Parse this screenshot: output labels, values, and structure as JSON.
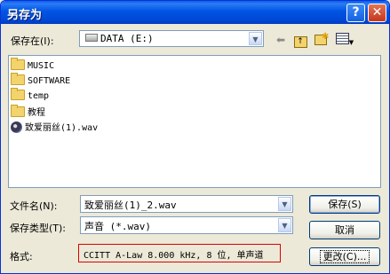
{
  "window": {
    "title": "另存为",
    "help_glyph": "?",
    "close_glyph": "✕"
  },
  "savein": {
    "label": "保存在(I):",
    "location": "DATA (E:)"
  },
  "toolbar": {
    "icons": [
      "back-icon",
      "up-folder-icon",
      "new-folder-icon",
      "view-menu-icon"
    ]
  },
  "files": [
    {
      "name": "MUSIC",
      "type": "folder"
    },
    {
      "name": "SOFTWARE",
      "type": "folder"
    },
    {
      "name": "temp",
      "type": "folder"
    },
    {
      "name": "教程",
      "type": "folder"
    },
    {
      "name": "致爱丽丝(1).wav",
      "type": "audio"
    }
  ],
  "filename": {
    "label": "文件名(N):",
    "value": "致爱丽丝(1)_2.wav"
  },
  "filetype": {
    "label": "保存类型(T):",
    "value": "声音 (*.wav)"
  },
  "format": {
    "label": "格式:",
    "value": "CCITT A-Law 8.000 kHz, 8 位, 单声道"
  },
  "buttons": {
    "save": "保存(S)",
    "cancel": "取消",
    "change": "更改(C)..."
  },
  "colors": {
    "title_bar": "#0054e3",
    "dialog_bg": "#ece9d8",
    "highlight_border": "#dd0000"
  }
}
